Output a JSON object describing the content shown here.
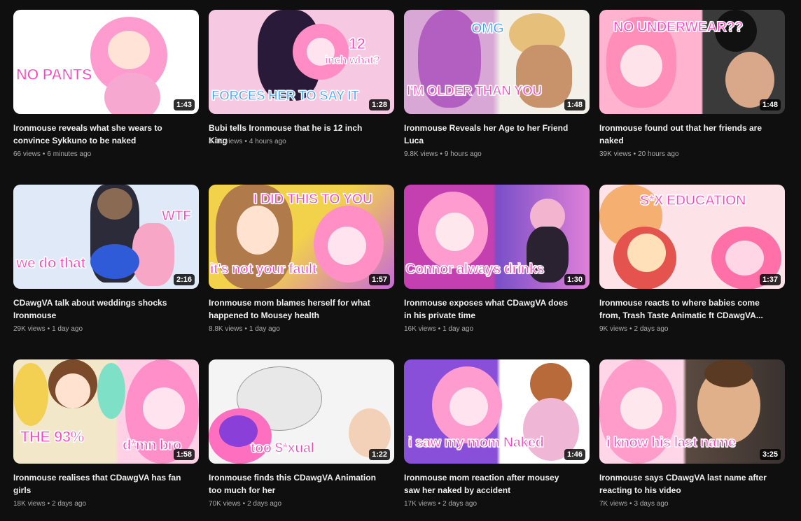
{
  "videos": [
    {
      "title": "Ironmouse reveals what she wears to convince Sykkuno to be naked",
      "views": "66 views",
      "age": "6 minutes ago",
      "duration": "1:43",
      "overlays": [
        "NO PANTS"
      ],
      "colors": [
        "#ffffff",
        "#ff9ccf"
      ]
    },
    {
      "title": "Bubi tells Ironmouse that he is 12 inch King",
      "views": "4.4K views",
      "age": "4 hours ago",
      "duration": "1:28",
      "overlays": [
        "12",
        "inch what?",
        "FORCES HER TO SAY IT"
      ],
      "colors": [
        "#f7c8e1",
        "#2a1a3a"
      ]
    },
    {
      "title": "Ironmouse Reveals her Age to her Friend Luca",
      "views": "9.8K views",
      "age": "9 hours ago",
      "duration": "1:48",
      "overlays": [
        "OMG",
        "I'M OLDER THAN YOU"
      ],
      "colors": [
        "#d9a7d6",
        "#e6c07a"
      ]
    },
    {
      "title": "Ironmouse found out that her friends are naked",
      "views": "39K views",
      "age": "20 hours ago",
      "duration": "1:48",
      "overlays": [
        "NO UNDERWEAR??"
      ],
      "colors": [
        "#ffb3cf",
        "#3a3a3a"
      ]
    },
    {
      "title": "CDawgVA talk about weddings shocks Ironmouse",
      "views": "29K views",
      "age": "1 day ago",
      "duration": "2:16",
      "overlays": [
        "WTF",
        "we do that"
      ],
      "colors": [
        "#dfe9f7",
        "#2b2b3a"
      ]
    },
    {
      "title": "Ironmouse mom blames herself for what happened to Mousey health",
      "views": "8.8K views",
      "age": "1 day ago",
      "duration": "1:57",
      "overlays": [
        "I DID THIS TO YOU",
        "it's not your fault"
      ],
      "colors": [
        "#f2d24a",
        "#b07a4a"
      ]
    },
    {
      "title": "Ironmouse exposes what CDawgVA does in his private time",
      "views": "16K views",
      "age": "1 day ago",
      "duration": "1:30",
      "overlays": [
        "Connor always drinks"
      ],
      "colors": [
        "#c43fb0",
        "#7a4fc8"
      ]
    },
    {
      "title": "Ironmouse reacts to where babies come from, Trash Taste Animatic ft CDawgVA...",
      "views": "9K views",
      "age": "2 days ago",
      "duration": "1:37",
      "overlays": [
        "S*X EDUCATION"
      ],
      "colors": [
        "#f5b071",
        "#e35a7a"
      ]
    },
    {
      "title": "Ironmouse realises that CDawgVA has fan girls",
      "views": "18K views",
      "age": "2 days ago",
      "duration": "1:58",
      "overlays": [
        "THE 93%",
        "d*mn bro"
      ],
      "colors": [
        "#f3e7c9",
        "#ff8fc8"
      ]
    },
    {
      "title": "Ironmouse finds this CDawgVA Animation too much for her",
      "views": "70K views",
      "age": "2 days ago",
      "duration": "1:22",
      "overlays": [
        "too $*xual"
      ],
      "colors": [
        "#f4f4f4",
        "#ff6fc0"
      ]
    },
    {
      "title": "Ironmouse mom reaction after mousey saw her naked by accident",
      "views": "17K views",
      "age": "2 days ago",
      "duration": "1:46",
      "overlays": [
        "i saw my mom Naked"
      ],
      "colors": [
        "#8a4fd8",
        "#f0b6d6"
      ]
    },
    {
      "title": "Ironmouse says CDawgVA last name after reacting to his video",
      "views": "7K views",
      "age": "3 days ago",
      "duration": "3:25",
      "overlays": [
        "i know his last name"
      ],
      "colors": [
        "#ff9cc9",
        "#5a4a40"
      ]
    }
  ]
}
